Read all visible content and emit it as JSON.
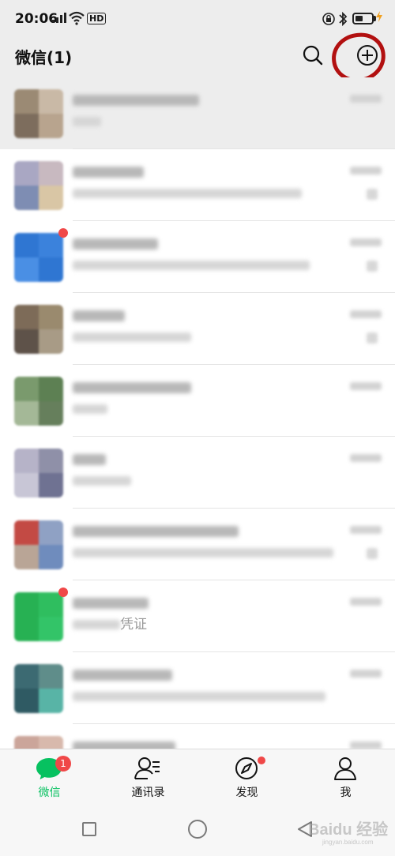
{
  "status_bar": {
    "time": "20:06",
    "hd_label": "HD"
  },
  "header": {
    "title": "微信(1)"
  },
  "chats": [
    {
      "avatar_colors": [
        "#9b8a74",
        "#c9b9a6",
        "#7d6d5d",
        "#b8a48e"
      ],
      "pinned": true,
      "dot": false
    },
    {
      "avatar_colors": [
        "#a9a7c3",
        "#c8b9c0",
        "#7e8db3",
        "#d9c6a5"
      ],
      "pinned": false,
      "dot": false
    },
    {
      "avatar_colors": [
        "#2f76d2",
        "#3b82dc",
        "#4a8fe4",
        "#2f76d2"
      ],
      "pinned": false,
      "dot": true
    },
    {
      "avatar_colors": [
        "#7d6b58",
        "#9a8a6e",
        "#5e5249",
        "#a89b86"
      ],
      "pinned": false,
      "dot": false
    },
    {
      "avatar_colors": [
        "#7a9a6d",
        "#5d8053",
        "#a4b897",
        "#667f5c"
      ],
      "pinned": false,
      "dot": false
    },
    {
      "avatar_colors": [
        "#b6b3c8",
        "#8f90a8",
        "#c8c6d6",
        "#6f7292"
      ],
      "pinned": false,
      "dot": false
    },
    {
      "avatar_colors": [
        "#c34a44",
        "#8fa1c4",
        "#b9a596",
        "#6f8cbd"
      ],
      "pinned": false,
      "dot": false
    },
    {
      "avatar_colors": [
        "#27b153",
        "#2fbe5f",
        "#27b153",
        "#33c468"
      ],
      "pinned": false,
      "dot": true,
      "visible_text": "凭证"
    },
    {
      "avatar_colors": [
        "#3c6a72",
        "#5f8d8a",
        "#2f5a63",
        "#58b4a6"
      ],
      "pinned": false,
      "dot": false
    },
    {
      "avatar_colors": [
        "#cba59a",
        "#d8b9ac",
        "#b78c83",
        "#e0c6bb"
      ],
      "pinned": false,
      "dot": false
    }
  ],
  "tabs": [
    {
      "label": "微信",
      "icon": "chat-bubble-icon",
      "badge": "1"
    },
    {
      "label": "通讯录",
      "icon": "contacts-icon"
    },
    {
      "label": "发现",
      "icon": "compass-icon"
    },
    {
      "label": "我",
      "icon": "person-icon"
    }
  ],
  "watermark": {
    "main": "Baidu 经验",
    "sub": "jingyan.baidu.com"
  },
  "colors": {
    "accent": "#07c160",
    "badge": "#f04848",
    "annotation": "#b21010"
  }
}
